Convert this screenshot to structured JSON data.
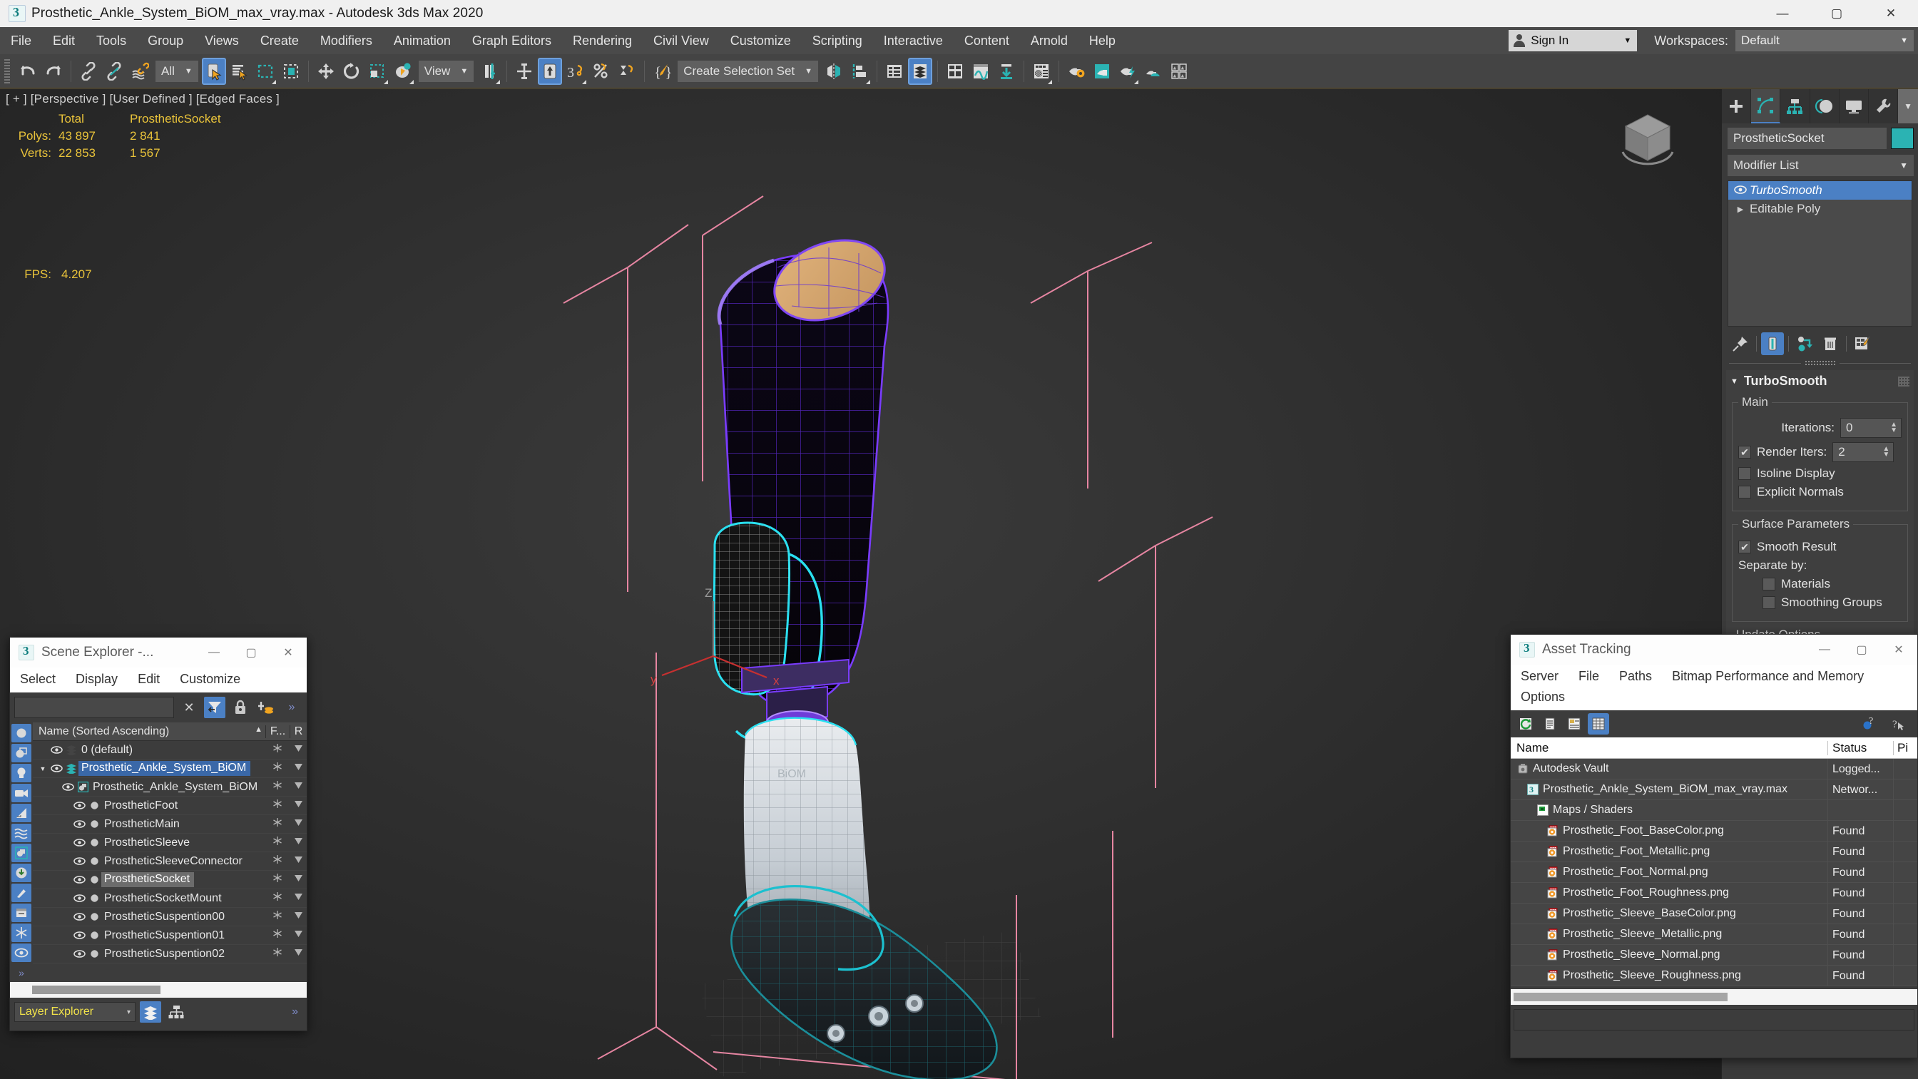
{
  "titlebar": {
    "title": "Prosthetic_Ankle_System_BiOM_max_vray.max - Autodesk 3ds Max 2020",
    "minimize": "—",
    "maximize": "▢",
    "close": "✕"
  },
  "menubar": {
    "items": [
      "File",
      "Edit",
      "Tools",
      "Group",
      "Views",
      "Create",
      "Modifiers",
      "Animation",
      "Graph Editors",
      "Rendering",
      "Civil View",
      "Customize",
      "Scripting",
      "Interactive",
      "Content",
      "Arnold",
      "Help"
    ],
    "sign_in": "Sign In",
    "workspaces_label": "Workspaces:",
    "workspace_value": "Default",
    "caret": "▼"
  },
  "toolbar": {
    "selection_filter": "All",
    "reference_coord": "View",
    "selection_set": "Create Selection Set",
    "caret": "▼"
  },
  "viewport": {
    "label": "[ + ] [Perspective ] [User Defined ] [Edged Faces ]",
    "stats": {
      "col1_header": "Total",
      "col2_header": "ProstheticSocket",
      "rows": [
        {
          "label": "Polys:",
          "total": "43 897",
          "object": "2 841"
        },
        {
          "label": "Verts:",
          "total": "22 853",
          "object": "1 567"
        }
      ],
      "fps_label": "FPS:",
      "fps_value": "4.207"
    },
    "axis_x": "x",
    "axis_y": "y",
    "axis_z": "Z"
  },
  "command_panel": {
    "tabs": [
      "create-tab",
      "modify-tab",
      "hierarchy-tab",
      "motion-tab",
      "display-tab",
      "utilities-tab"
    ],
    "object_name": "ProstheticSocket",
    "object_color": "#2bb3b3",
    "modifier_list_label": "Modifier List",
    "stack": [
      {
        "name": "TurboSmooth",
        "selected": true,
        "eye": "◉"
      },
      {
        "name": "Editable Poly",
        "selected": false,
        "arrow": "▶"
      }
    ],
    "rollout": {
      "title": "TurboSmooth",
      "main_group": "Main",
      "iterations_label": "Iterations:",
      "iterations_value": "0",
      "render_iters_label": "Render Iters:",
      "render_iters_value": "2",
      "render_iters_checked": true,
      "isoline_display": "Isoline Display",
      "isoline_checked": false,
      "explicit_normals": "Explicit Normals",
      "explicit_checked": false,
      "surface_group": "Surface Parameters",
      "smooth_result": "Smooth Result",
      "smooth_checked": true,
      "separate_by": "Separate by:",
      "materials": "Materials",
      "materials_checked": false,
      "smoothing_groups": "Smoothing Groups",
      "smoothing_checked": false,
      "update_options": "Update Options"
    }
  },
  "scene_explorer": {
    "title": "Scene Explorer -...",
    "minimize": "—",
    "maximize": "▢",
    "close": "✕",
    "menu": [
      "Select",
      "Display",
      "Edit",
      "Customize"
    ],
    "search_value": "",
    "clear_icon": "✕",
    "overflow": "»",
    "columns": {
      "name": "Name (Sorted Ascending)",
      "sort_arrow": "▲",
      "freeze": "F...",
      "render": "R"
    },
    "rows": [
      {
        "name": "0 (default)",
        "indent": 1,
        "kind": "layer",
        "expander": "",
        "state": "normal"
      },
      {
        "name": "Prosthetic_Ankle_System_BiOM",
        "indent": 1,
        "kind": "layer",
        "expander": "▼",
        "state": "selected"
      },
      {
        "name": "Prosthetic_Ankle_System_BiOM",
        "indent": 2,
        "kind": "group",
        "expander": "",
        "state": "normal"
      },
      {
        "name": "ProstheticFoot",
        "indent": 3,
        "kind": "mesh",
        "expander": "",
        "state": "normal"
      },
      {
        "name": "ProstheticMain",
        "indent": 3,
        "kind": "mesh",
        "expander": "",
        "state": "normal"
      },
      {
        "name": "ProstheticSleeve",
        "indent": 3,
        "kind": "mesh",
        "expander": "",
        "state": "normal"
      },
      {
        "name": "ProstheticSleeveConnector",
        "indent": 3,
        "kind": "mesh",
        "expander": "",
        "state": "normal"
      },
      {
        "name": "ProstheticSocket",
        "indent": 3,
        "kind": "mesh",
        "expander": "",
        "state": "highlight"
      },
      {
        "name": "ProstheticSocketMount",
        "indent": 3,
        "kind": "mesh",
        "expander": "",
        "state": "normal"
      },
      {
        "name": "ProstheticSuspention00",
        "indent": 3,
        "kind": "mesh",
        "expander": "",
        "state": "normal"
      },
      {
        "name": "ProstheticSuspention01",
        "indent": 3,
        "kind": "mesh",
        "expander": "",
        "state": "normal"
      },
      {
        "name": "ProstheticSuspention02",
        "indent": 3,
        "kind": "mesh",
        "expander": "",
        "state": "normal"
      }
    ],
    "footer_combo": "Layer Explorer",
    "footer_caret": "▾",
    "footer_overflow": "»"
  },
  "asset_tracking": {
    "title": "Asset Tracking",
    "minimize": "—",
    "maximize": "▢",
    "close": "✕",
    "menu": [
      "Server",
      "File",
      "Paths",
      "Bitmap Performance and Memory",
      "Options"
    ],
    "columns": {
      "name": "Name",
      "status": "Status",
      "path": "Pi"
    },
    "rows": [
      {
        "name": "Autodesk Vault",
        "status": "Logged...",
        "indent": 1,
        "icon": "vault-icon"
      },
      {
        "name": "Prosthetic_Ankle_System_BiOM_max_vray.max",
        "status": "Networ...",
        "indent": 2,
        "icon": "max-file-icon"
      },
      {
        "name": "Maps / Shaders",
        "status": "",
        "indent": 3,
        "icon": "maps-icon"
      },
      {
        "name": "Prosthetic_Foot_BaseColor.png",
        "status": "Found",
        "indent": 4,
        "icon": "bitmap-icon"
      },
      {
        "name": "Prosthetic_Foot_Metallic.png",
        "status": "Found",
        "indent": 4,
        "icon": "bitmap-icon"
      },
      {
        "name": "Prosthetic_Foot_Normal.png",
        "status": "Found",
        "indent": 4,
        "icon": "bitmap-icon"
      },
      {
        "name": "Prosthetic_Foot_Roughness.png",
        "status": "Found",
        "indent": 4,
        "icon": "bitmap-icon"
      },
      {
        "name": "Prosthetic_Sleeve_BaseColor.png",
        "status": "Found",
        "indent": 4,
        "icon": "bitmap-icon"
      },
      {
        "name": "Prosthetic_Sleeve_Metallic.png",
        "status": "Found",
        "indent": 4,
        "icon": "bitmap-icon"
      },
      {
        "name": "Prosthetic_Sleeve_Normal.png",
        "status": "Found",
        "indent": 4,
        "icon": "bitmap-icon"
      },
      {
        "name": "Prosthetic_Sleeve_Roughness.png",
        "status": "Found",
        "indent": 4,
        "icon": "bitmap-icon"
      }
    ]
  },
  "colors": {
    "accent_blue": "#4b80c4",
    "teal": "#2bb3b3",
    "stats_yellow": "#e9c33a",
    "gizmo_pink": "#f08aa8",
    "selection_white": "#ffffff",
    "socket_purple": "#6a2bd6",
    "sleeve_cyan": "#29e0f0",
    "liner_tan": "#d4a76a"
  }
}
